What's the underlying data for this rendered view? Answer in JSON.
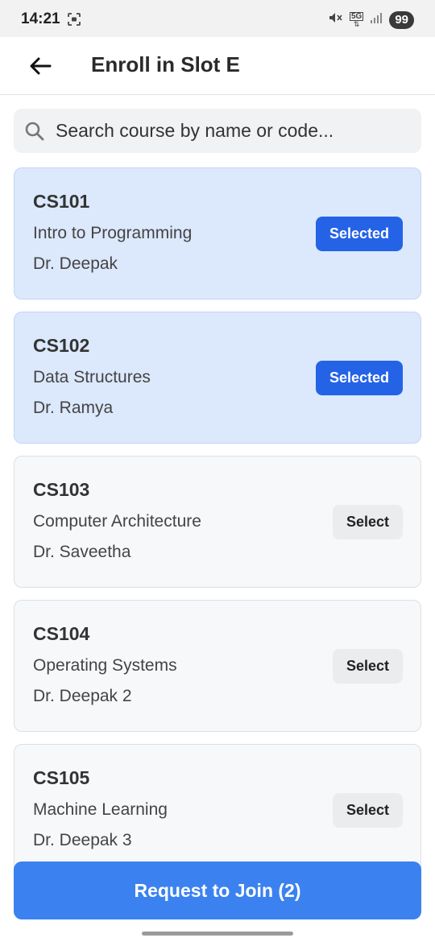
{
  "status_bar": {
    "time": "14:21",
    "network": "5G",
    "battery": "99"
  },
  "header": {
    "title": "Enroll in Slot E",
    "back_icon": "arrow-left-icon"
  },
  "search": {
    "placeholder": "Search course by name or code...",
    "value": "",
    "icon": "search-icon"
  },
  "courses": [
    {
      "code": "CS101",
      "name": "Intro to Programming",
      "instructor": "Dr. Deepak",
      "button_label": "Selected",
      "selected": true
    },
    {
      "code": "CS102",
      "name": "Data Structures",
      "instructor": "Dr. Ramya",
      "button_label": "Selected",
      "selected": true
    },
    {
      "code": "CS103",
      "name": "Computer Architecture",
      "instructor": "Dr. Saveetha",
      "button_label": "Select",
      "selected": false
    },
    {
      "code": "CS104",
      "name": "Operating Systems",
      "instructor": "Dr. Deepak 2",
      "button_label": "Select",
      "selected": false
    },
    {
      "code": "CS105",
      "name": "Machine Learning",
      "instructor": "Dr. Deepak 3",
      "button_label": "Select",
      "selected": false
    }
  ],
  "footer": {
    "request_label": "Request to Join (2)"
  },
  "colors": {
    "accent": "#2563e6",
    "request_button": "#3b82f0",
    "selected_card": "#dce8fc"
  }
}
